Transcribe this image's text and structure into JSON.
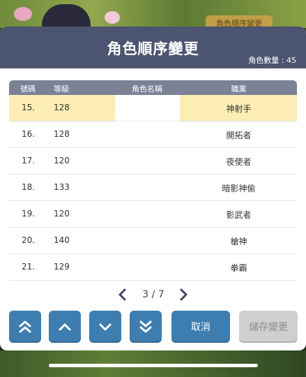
{
  "background": {
    "ghost_button_label": "角色順序變更"
  },
  "modal": {
    "title": "角色順序變更",
    "character_count": "角色數量 : 45",
    "columns": [
      "號碼",
      "等級",
      "角色名稱",
      "職業"
    ],
    "rows": [
      {
        "no": "15.",
        "level": "128",
        "job": "神射手",
        "selected": true
      },
      {
        "no": "16.",
        "level": "128",
        "job": "開拓者"
      },
      {
        "no": "17.",
        "level": "120",
        "job": "夜使者"
      },
      {
        "no": "18.",
        "level": "133",
        "job": "暗影神偷"
      },
      {
        "no": "19.",
        "level": "120",
        "job": "影武者"
      },
      {
        "no": "20.",
        "level": "140",
        "job": "槍神"
      },
      {
        "no": "21.",
        "level": "129",
        "job": "拳霸"
      }
    ],
    "pager": {
      "text": "3 / 7"
    },
    "buttons": {
      "move_top_icon": "double-chevron-up-icon",
      "move_up_icon": "chevron-up-icon",
      "move_down_icon": "chevron-down-icon",
      "move_bottom_icon": "double-chevron-down-icon",
      "cancel": "取消",
      "save": "儲存變更"
    },
    "colors": {
      "header": "#4b5470",
      "table_head": "#7b8296",
      "selected_row": "#fbedb3",
      "button_blue": "#3d7db0",
      "button_disabled": "#cfcfcf"
    }
  }
}
